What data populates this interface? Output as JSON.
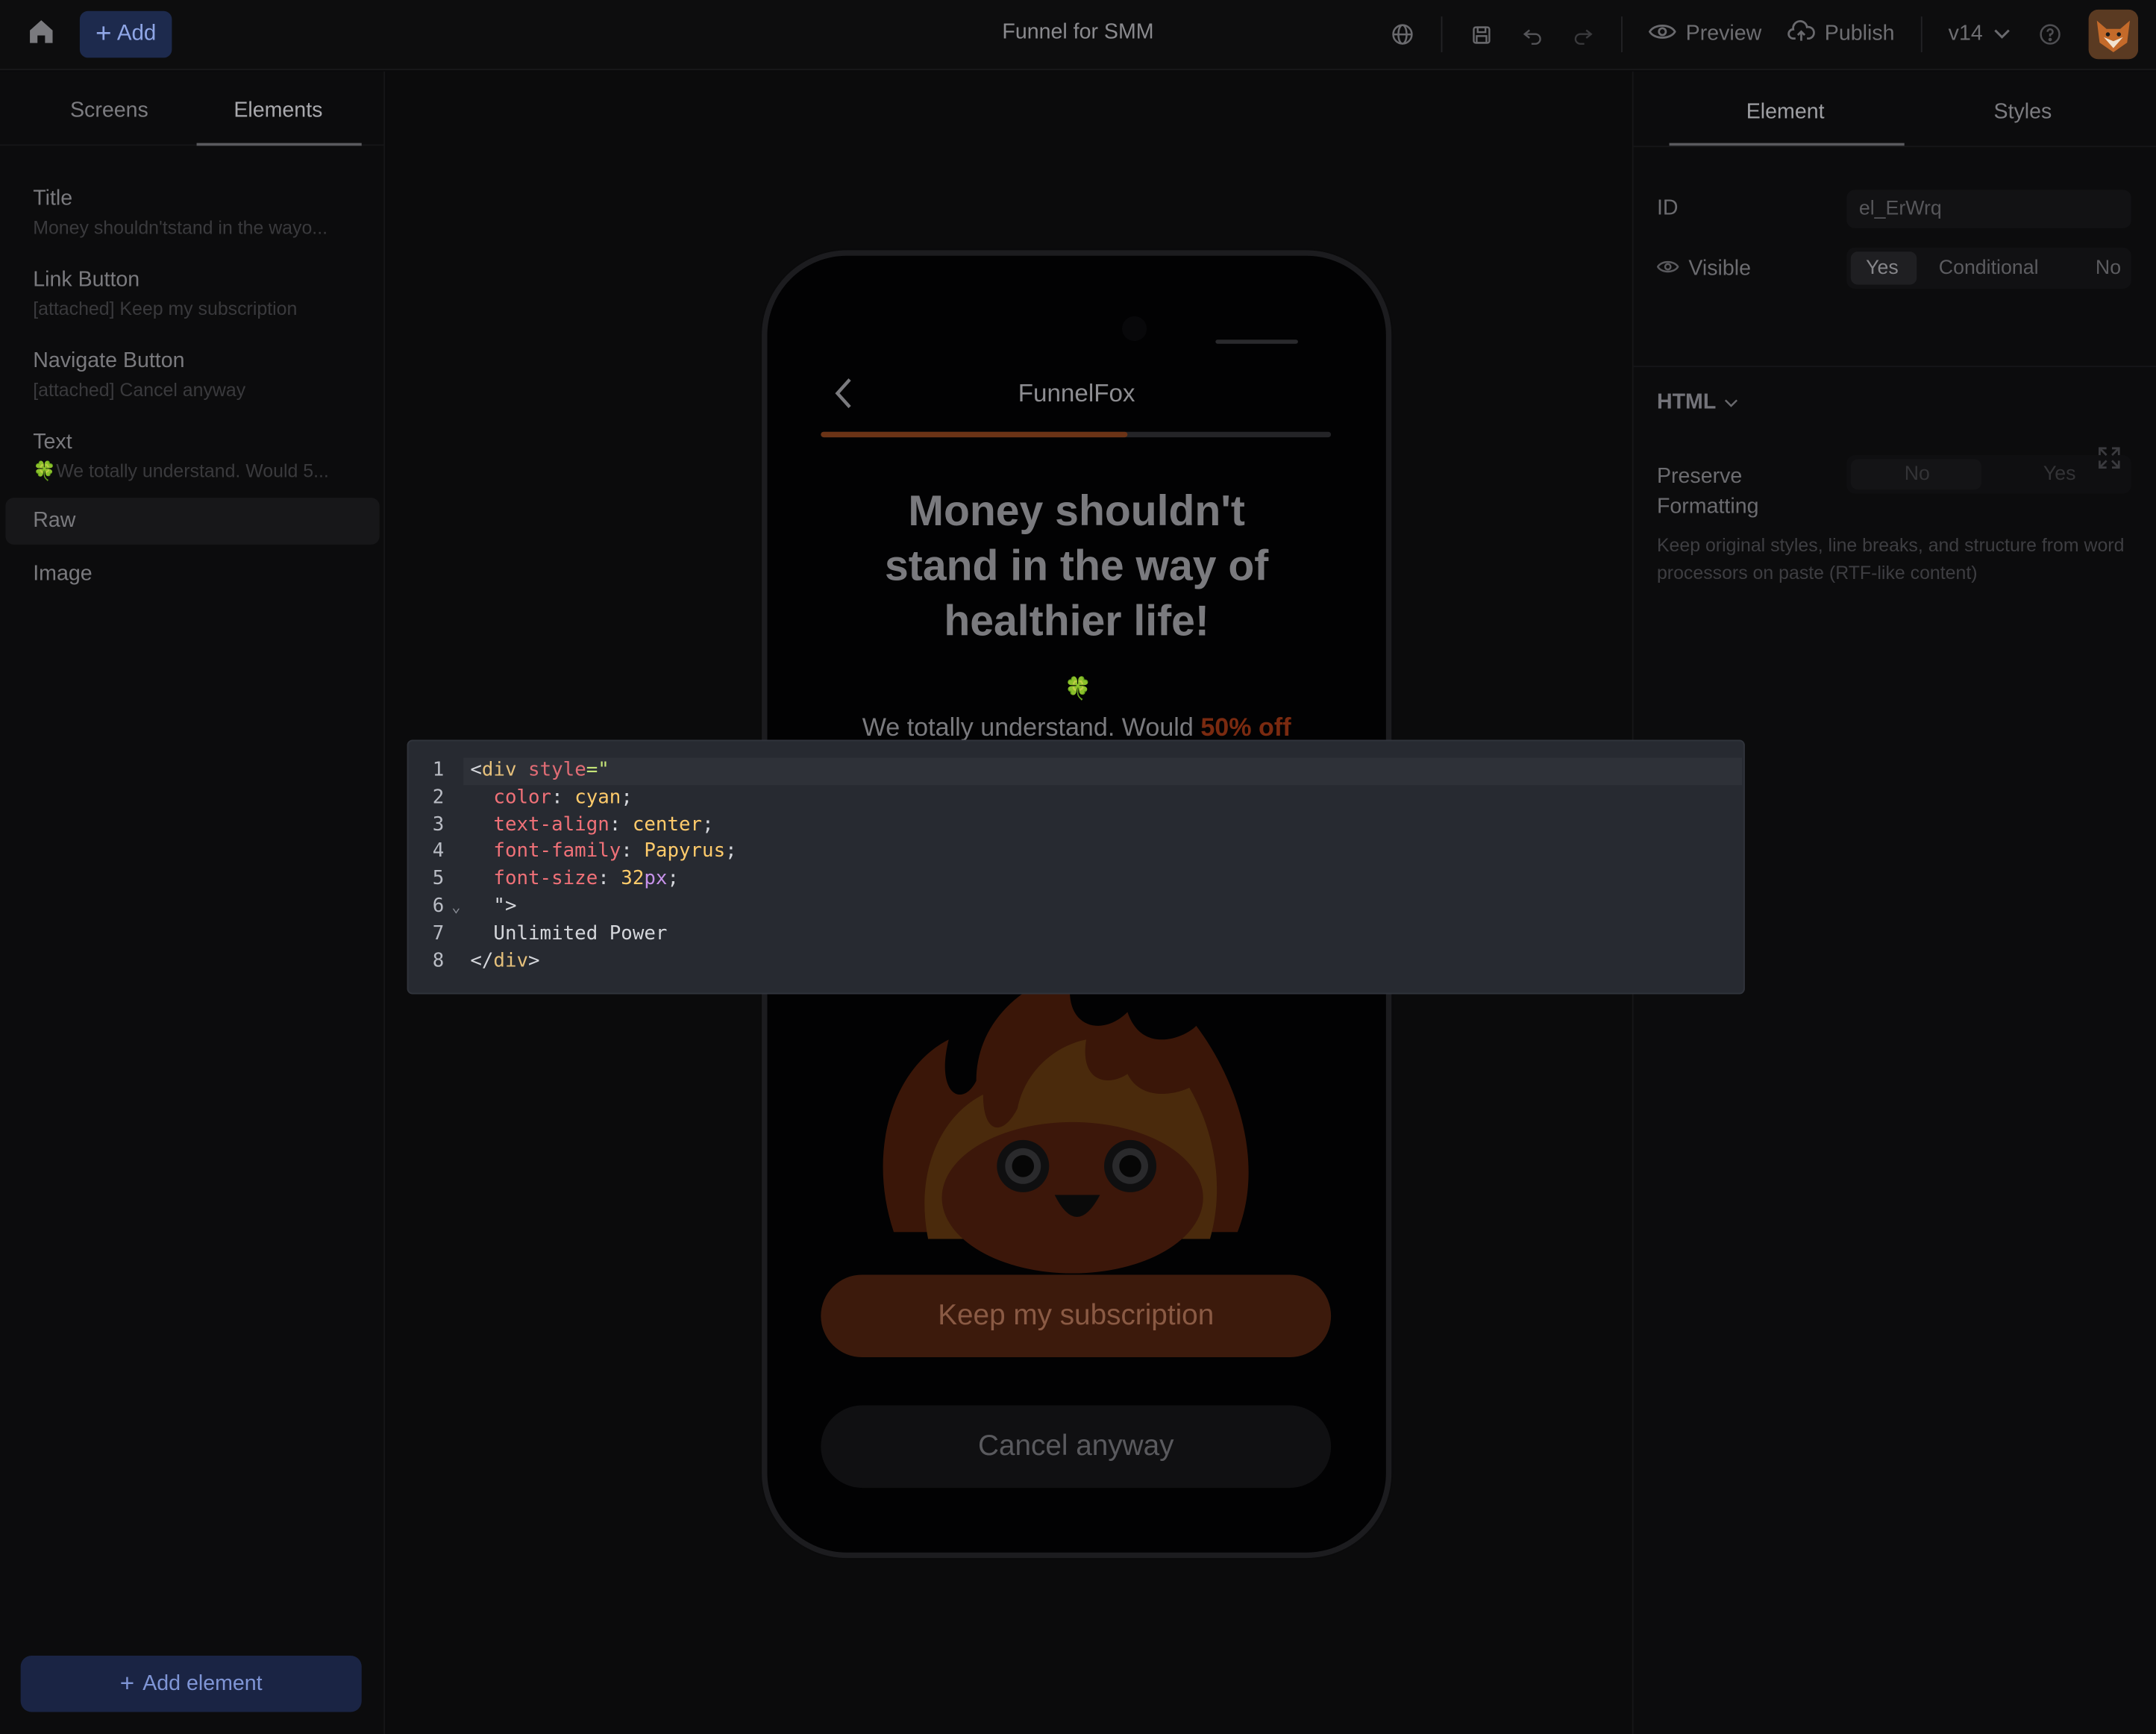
{
  "topbar": {
    "add_label": "Add",
    "title": "Funnel for SMM",
    "preview_label": "Preview",
    "publish_label": "Publish",
    "version": "v14",
    "icons": [
      "home-icon",
      "globe-icon",
      "save-icon",
      "undo-icon",
      "redo-icon",
      "eye-icon",
      "cloud-upload-icon",
      "chevron-down-icon",
      "help-icon"
    ]
  },
  "left_panel": {
    "tabs": [
      {
        "label": "Screens",
        "active": false
      },
      {
        "label": "Elements",
        "active": true
      }
    ],
    "elements": [
      {
        "name": "Title",
        "sub": "Money shouldn'tstand in the wayo..."
      },
      {
        "name": "Link Button",
        "sub": "[attached] Keep my subscription"
      },
      {
        "name": "Navigate Button",
        "sub": "[attached] Cancel anyway"
      },
      {
        "name": "Text",
        "sub": "🍀We totally understand. Would 5..."
      },
      {
        "name": "Raw",
        "sub": "",
        "selected": true
      },
      {
        "name": "Image",
        "sub": ""
      }
    ],
    "add_element_label": "Add element"
  },
  "phone": {
    "brand": "FunnelFox",
    "progress": 0.6,
    "headline": "Money shouldn't stand in the way of healthier life!",
    "leaf_glyph": "🍀",
    "text_main": "We totally understand. Would ",
    "text_highlight": "50% off",
    "keep_label": "Keep my subscription",
    "cancel_label": "Cancel anyway"
  },
  "right_panel": {
    "tabs": [
      {
        "label": "Element",
        "active": true
      },
      {
        "label": "Styles",
        "active": false
      }
    ],
    "id_label": "ID",
    "id_value": "el_ErWrq",
    "visible_label": "Visible",
    "visible_options": [
      "Yes",
      "Conditional",
      "No"
    ],
    "visible_selected": "Yes",
    "html_section_label": "HTML",
    "preserve_label_1": "Preserve",
    "preserve_label_2": "Formatting",
    "preserve_options": [
      "No",
      "Yes"
    ],
    "preserve_selected": "No",
    "help_text": "Keep original styles, line breaks, and structure from word processors on paste (RTF-like content)"
  },
  "editor": {
    "line_numbers": [
      "1",
      "2",
      "3",
      "4",
      "5",
      "6",
      "7",
      "8"
    ],
    "lines": {
      "l1_open": "<",
      "l1_tag": "div",
      "l1_attr": " style",
      "l1_eq": "=\"",
      "l2_prop": "color",
      "l2_colon": ": ",
      "l2_val": "cyan",
      "l2_semi": ";",
      "l3_prop": "text-align",
      "l3_colon": ": ",
      "l3_val": "center",
      "l3_semi": ";",
      "l4_prop": "font-family",
      "l4_colon": ": ",
      "l4_val": "Papyrus",
      "l4_semi": ";",
      "l5_prop": "font-size",
      "l5_colon": ": ",
      "l5_num": "32",
      "l5_unit": "px",
      "l5_semi": ";",
      "l6_text": "\">",
      "l7_text": "Unlimited Power",
      "l8_open": "</",
      "l8_tag": "div",
      "l8_close": ">"
    }
  },
  "colors": {
    "accent_blue": "#1d2a4d",
    "brand_orange": "#6b3316",
    "editor_bg": "#272a31"
  }
}
